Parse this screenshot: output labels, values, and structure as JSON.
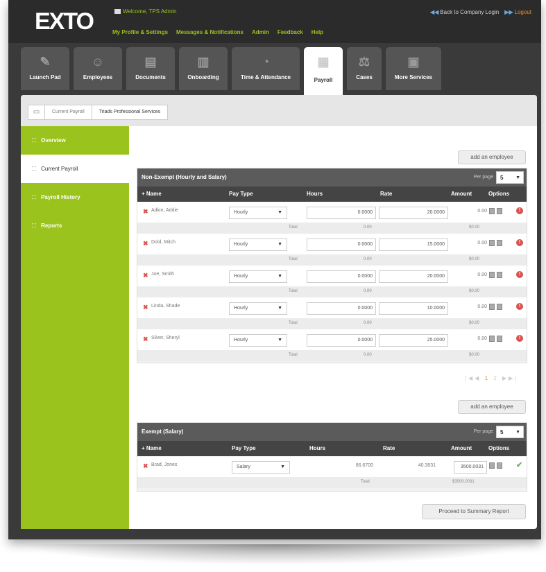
{
  "header": {
    "logo": "EXTO",
    "welcome": "Welcome, TPS Admin",
    "nav": [
      "My Profile & Settings",
      "Messages & Notifications",
      "Admin",
      "Feedback",
      "Help"
    ],
    "back_link": "Back to Company Login",
    "logout": "Logout"
  },
  "modules": [
    {
      "label": "Launch Pad",
      "icon": "rocket-icon",
      "glyph": "✎"
    },
    {
      "label": "Employees",
      "icon": "people-icon",
      "glyph": "☺"
    },
    {
      "label": "Documents",
      "icon": "document-icon",
      "glyph": "▤"
    },
    {
      "label": "Onboarding",
      "icon": "clipboard-icon",
      "glyph": "▥"
    },
    {
      "label": "Time & Attendance",
      "icon": "clock-icon",
      "glyph": "◔"
    },
    {
      "label": "Payroll",
      "icon": "payroll-icon",
      "glyph": "▦",
      "active": true
    },
    {
      "label": "Cases",
      "icon": "scales-icon",
      "glyph": "⚖"
    },
    {
      "label": "More Services",
      "icon": "services-icon",
      "glyph": "▣"
    }
  ],
  "breadcrumb": [
    "Current Payroll",
    "Triads Professional Services"
  ],
  "sidebar": [
    {
      "label": "Overview",
      "active": false
    },
    {
      "label": "Current Payroll",
      "active": true
    },
    {
      "label": "Payroll History",
      "active": false
    },
    {
      "label": "Reports",
      "active": false
    }
  ],
  "buttons": {
    "add_employee": "add an employee",
    "proceed": "Proceed to Summary Report"
  },
  "nonexempt": {
    "title": "Non-Exempt (Hourly and Salary)",
    "per_page_label": "Per page",
    "per_page_value": "5",
    "columns": [
      "+ Name",
      "Pay Type",
      "Hours",
      "Rate",
      "Amount",
      "Options"
    ],
    "rows": [
      {
        "name": "Adkin, Addie",
        "pay_type": "Hourly",
        "hours": "0.0000",
        "rate": "20.0000",
        "amount": "0.00",
        "total_label": "Total",
        "total_hours": "0.00",
        "total_amount": "$0.00"
      },
      {
        "name": "Dold, Mitch",
        "pay_type": "Hourly",
        "hours": "0.0000",
        "rate": "15.0000",
        "amount": "0.00",
        "total_label": "Total",
        "total_hours": "0.00",
        "total_amount": "$0.00"
      },
      {
        "name": "Joe, Smith",
        "pay_type": "Hourly",
        "hours": "0.0000",
        "rate": "20.0000",
        "amount": "0.00",
        "total_label": "Total",
        "total_hours": "0.00",
        "total_amount": "$0.00"
      },
      {
        "name": "Linda, Shade",
        "pay_type": "Hourly",
        "hours": "0.0000",
        "rate": "10.0000",
        "amount": "0.00",
        "total_label": "Total",
        "total_hours": "0.00",
        "total_amount": "$0.00"
      },
      {
        "name": "Silver, Sheryl",
        "pay_type": "Hourly",
        "hours": "0.0000",
        "rate": "25.0000",
        "amount": "0.00",
        "total_label": "Total",
        "total_hours": "0.00",
        "total_amount": "$0.00"
      }
    ],
    "pager": {
      "pages": [
        "1",
        "2"
      ],
      "current": "1"
    }
  },
  "exempt": {
    "title": "Exempt (Salary)",
    "per_page_label": "Per page",
    "per_page_value": "5",
    "columns": [
      "+ Name",
      "Pay Type",
      "Hours",
      "Rate",
      "Amount",
      "Options"
    ],
    "rows": [
      {
        "name": "Brad, Jones",
        "pay_type": "Salary",
        "hours": "86.6700",
        "rate": "40.3831",
        "amount": "3500.0031",
        "total_label": "Total",
        "total_amount": "$3500.0031"
      }
    ]
  },
  "colors": {
    "accent": "#9bc31d",
    "header_bg": "#2b2b2b",
    "logout": "#f08a24"
  }
}
